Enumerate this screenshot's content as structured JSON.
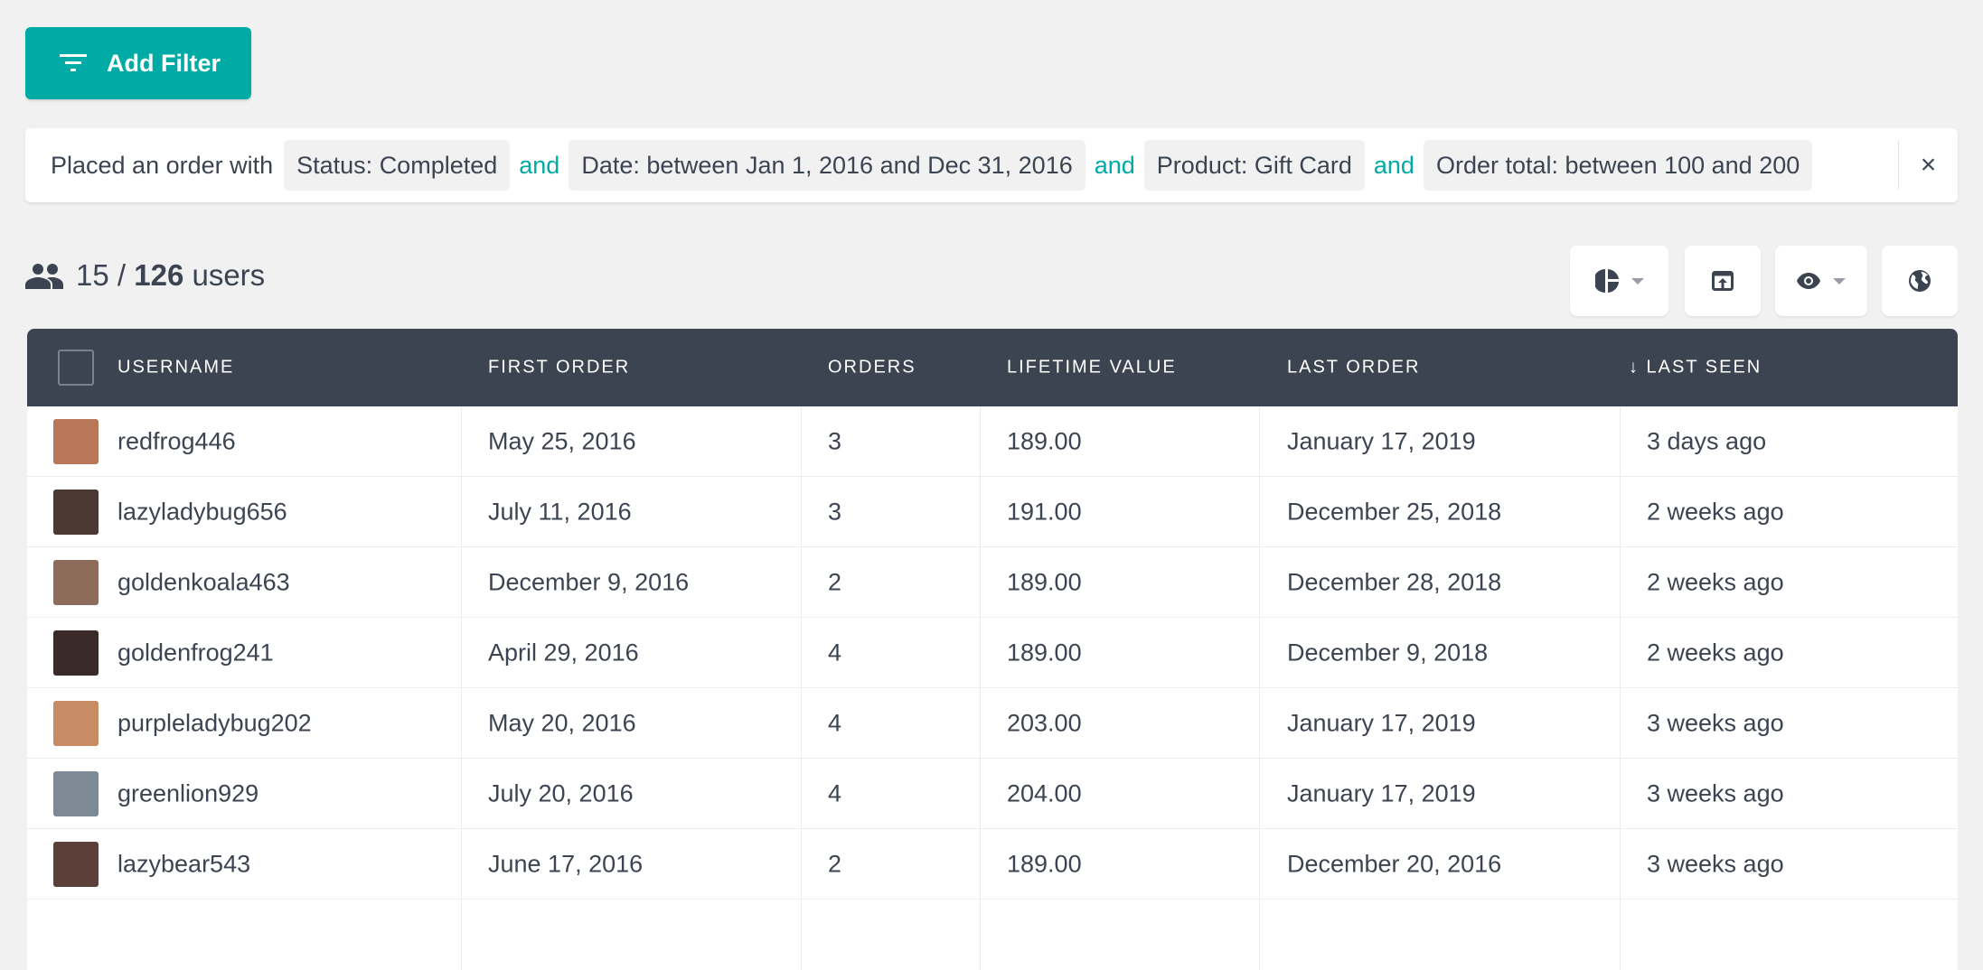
{
  "add_filter": {
    "label": "Add Filter",
    "icon": "filter-icon",
    "color": "#00aba6"
  },
  "filter": {
    "lead": "Placed an order with",
    "conjunction": "and",
    "conditions": [
      "Status: Completed",
      "Date: between Jan 1, 2016 and Dec 31, 2016",
      "Product: Gift Card",
      "Order total: between 100 and 200"
    ],
    "close": "×"
  },
  "summary": {
    "shown": "15",
    "separator": " / ",
    "total": "126",
    "unit": " users"
  },
  "toolbar": [
    "pie-chart-icon",
    "export-icon",
    "eye-icon",
    "globe-icon"
  ],
  "table": {
    "columns": [
      "USERNAME",
      "FIRST ORDER",
      "ORDERS",
      "LIFETIME VALUE",
      "LAST ORDER",
      "↓ LAST SEEN"
    ],
    "rows": [
      {
        "username": "redfrog446",
        "first_order": "May 25, 2016",
        "orders": "3",
        "ltv": "189.00",
        "last_order": "January 17, 2019",
        "last_seen": "3 days ago",
        "avatar": "#b9775a"
      },
      {
        "username": "lazyladybug656",
        "first_order": "July 11, 2016",
        "orders": "3",
        "ltv": "191.00",
        "last_order": "December 25, 2018",
        "last_seen": "2 weeks ago",
        "avatar": "#4b3a34"
      },
      {
        "username": "goldenkoala463",
        "first_order": "December 9, 2016",
        "orders": "2",
        "ltv": "189.00",
        "last_order": "December 28, 2018",
        "last_seen": "2 weeks ago",
        "avatar": "#8d6c5c"
      },
      {
        "username": "goldenfrog241",
        "first_order": "April 29, 2016",
        "orders": "4",
        "ltv": "189.00",
        "last_order": "December 9, 2018",
        "last_seen": "2 weeks ago",
        "avatar": "#3a2a28"
      },
      {
        "username": "purpleladybug202",
        "first_order": "May 20, 2016",
        "orders": "4",
        "ltv": "203.00",
        "last_order": "January 17, 2019",
        "last_seen": "3 weeks ago",
        "avatar": "#c88c64"
      },
      {
        "username": "greenlion929",
        "first_order": "July 20, 2016",
        "orders": "4",
        "ltv": "204.00",
        "last_order": "January 17, 2019",
        "last_seen": "3 weeks ago",
        "avatar": "#7d8a95"
      },
      {
        "username": "lazybear543",
        "first_order": "June 17, 2016",
        "orders": "2",
        "ltv": "189.00",
        "last_order": "December 20, 2016",
        "last_seen": "3 weeks ago",
        "avatar": "#5a4038"
      }
    ]
  }
}
